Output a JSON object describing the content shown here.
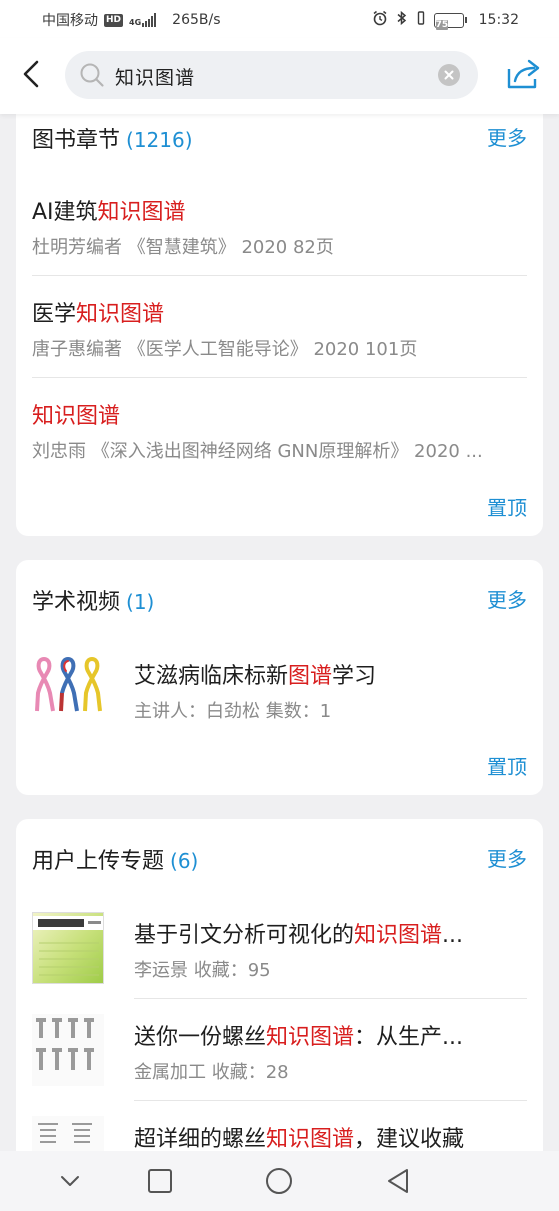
{
  "status_bar": {
    "carrier": "中国移动",
    "hd": "HD",
    "net_type": "4G",
    "speed": "265B/s",
    "battery": "75",
    "time": "15:32"
  },
  "header": {
    "search_value": "知识图谱",
    "icons": [
      "back-arrow-icon",
      "search-icon",
      "clear-icon",
      "share-icon"
    ]
  },
  "colors": {
    "accent": "#1e8fd3",
    "highlight": "#d81e1e",
    "meta": "#8a8a8a"
  },
  "book_section": {
    "title": "图书章节",
    "count": "(1216)",
    "more": "更多",
    "pin": "置顶",
    "items": [
      {
        "prefix": "AI建筑",
        "highlight": "知识图谱",
        "suffix": "",
        "meta": "杜明芳编者 《智慧建筑》 2020 82页"
      },
      {
        "prefix": "医学",
        "highlight": "知识图谱",
        "suffix": "",
        "meta": "唐子惠编著 《医学人工智能导论》 2020 101页"
      },
      {
        "prefix": "",
        "highlight": "知识图谱",
        "suffix": "",
        "meta": "刘忠雨 《深入浅出图神经网络 GNN原理解析》 2020 ..."
      }
    ]
  },
  "video_section": {
    "title": "学术视频",
    "count": "(1)",
    "more": "更多",
    "pin": "置顶",
    "items": [
      {
        "prefix": "艾滋病临床标新",
        "highlight": "图谱",
        "suffix": "学习",
        "meta": "主讲人：白劲松   集数：1"
      }
    ]
  },
  "upload_section": {
    "title": "用户上传专题",
    "count": "(6)",
    "more": "更多",
    "items": [
      {
        "prefix": "基于引文分析可视化的",
        "highlight": "知识图谱",
        "suffix": "...",
        "meta": "李运景 收藏：95"
      },
      {
        "prefix": "送你一份螺丝",
        "highlight": "知识图谱",
        "suffix": "：从生产...",
        "meta": "金属加工 收藏：28"
      },
      {
        "prefix": "超详细的螺丝",
        "highlight": "知识图谱",
        "suffix": "，建议收藏",
        "meta": ""
      }
    ]
  },
  "nav_bar": {
    "buttons": [
      "back-nav-icon",
      "home-nav-icon",
      "recents-nav-icon",
      "collapse-nav-icon"
    ]
  }
}
